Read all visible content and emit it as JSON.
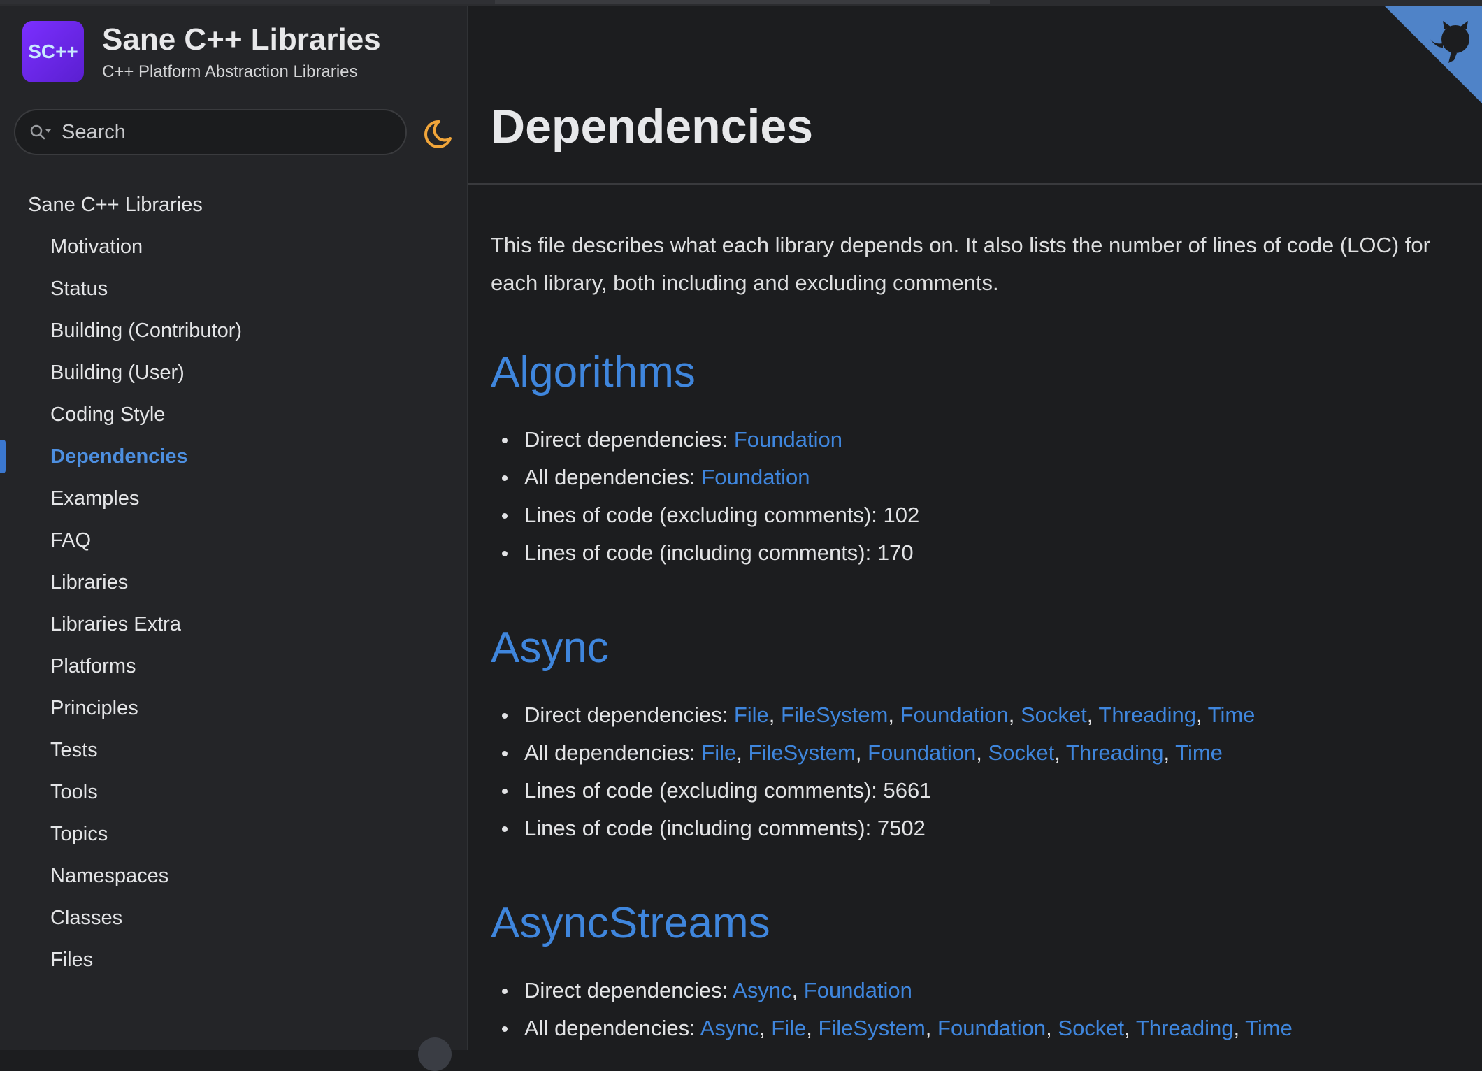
{
  "brand": {
    "logo_text": "SC++",
    "title": "Sane C++ Libraries",
    "subtitle": "C++ Platform Abstraction Libraries"
  },
  "search": {
    "placeholder": "Search"
  },
  "nav": {
    "root_label": "Sane C++ Libraries",
    "items": [
      "Motivation",
      "Status",
      "Building (Contributor)",
      "Building (User)",
      "Coding Style",
      "Dependencies",
      "Examples",
      "FAQ",
      "Libraries",
      "Libraries Extra",
      "Platforms",
      "Principles",
      "Tests",
      "Tools",
      "Topics",
      "Namespaces",
      "Classes",
      "Files"
    ],
    "active": "Dependencies"
  },
  "page": {
    "title": "Dependencies",
    "intro": "This file describes what each library depends on. It also lists the number of lines of code (LOC) for each library, both including and excluding comments."
  },
  "labels": {
    "direct": "Direct dependencies: ",
    "all": "All dependencies: ",
    "loc_excl": "Lines of code (excluding comments): ",
    "loc_incl": "Lines of code (including comments): "
  },
  "sections": [
    {
      "name": "Algorithms",
      "direct": [
        "Foundation"
      ],
      "all": [
        "Foundation"
      ],
      "loc_excl": "102",
      "loc_incl": "170"
    },
    {
      "name": "Async",
      "direct": [
        "File",
        "FileSystem",
        "Foundation",
        "Socket",
        "Threading",
        "Time"
      ],
      "all": [
        "File",
        "FileSystem",
        "Foundation",
        "Socket",
        "Threading",
        "Time"
      ],
      "loc_excl": "5661",
      "loc_incl": "7502"
    },
    {
      "name": "AsyncStreams",
      "direct": [
        "Async",
        "Foundation"
      ],
      "all": [
        "Async",
        "File",
        "FileSystem",
        "Foundation",
        "Socket",
        "Threading",
        "Time"
      ]
    }
  ],
  "colors": {
    "link": "#3f86dd",
    "active_nav": "#4d8fe0",
    "logo_bg": "#7b2fff",
    "theme_toggle": "#f0a53a"
  },
  "icons": {
    "search": "search-icon",
    "theme": "moon-icon",
    "corner": "github-octocat-icon"
  }
}
